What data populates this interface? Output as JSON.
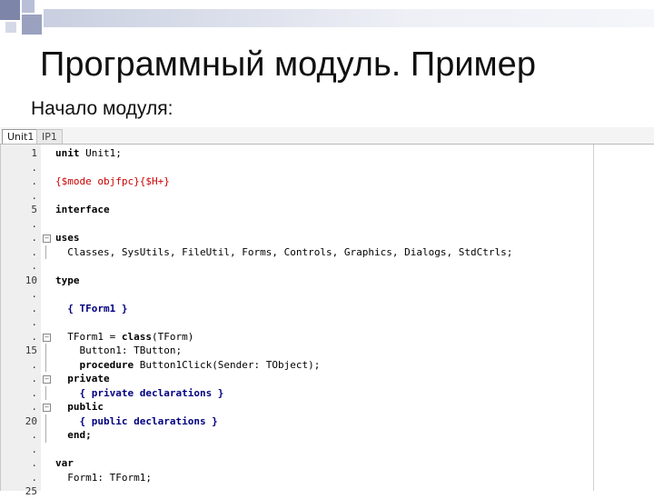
{
  "slide": {
    "title": "Программный модуль. Пример",
    "subtitle": "Начало модуля:"
  },
  "editor": {
    "tabs": [
      {
        "label": "Unit1",
        "active": true
      },
      {
        "label": "IP1",
        "active": false
      }
    ],
    "line_numbers": [
      "1",
      ".",
      ".",
      ".",
      "5",
      ".",
      ".",
      ".",
      ".",
      "10",
      ".",
      ".",
      ".",
      ".",
      "15",
      ".",
      ".",
      ".",
      ".",
      "20",
      ".",
      ".",
      ".",
      ".",
      "25"
    ],
    "code_lines": [
      {
        "segments": [
          {
            "t": "unit ",
            "c": "kw"
          },
          {
            "t": "Unit1;",
            "c": "id"
          }
        ]
      },
      {
        "segments": []
      },
      {
        "segments": [
          {
            "t": "{$mode objfpc}{$H+}",
            "c": "dir"
          }
        ]
      },
      {
        "segments": []
      },
      {
        "segments": [
          {
            "t": "interface",
            "c": "kw"
          }
        ]
      },
      {
        "segments": []
      },
      {
        "segments": [
          {
            "t": "uses",
            "c": "kw"
          }
        ]
      },
      {
        "segments": [
          {
            "t": "  Classes, SysUtils, FileUtil, Forms, Controls, Graphics, Dialogs, StdCtrls;",
            "c": "id"
          }
        ]
      },
      {
        "segments": []
      },
      {
        "segments": [
          {
            "t": "type",
            "c": "kw"
          }
        ]
      },
      {
        "segments": []
      },
      {
        "segments": [
          {
            "t": "  { TForm1 }",
            "c": "cm"
          }
        ]
      },
      {
        "segments": []
      },
      {
        "segments": [
          {
            "t": "  TForm1 = ",
            "c": "id"
          },
          {
            "t": "class",
            "c": "kw"
          },
          {
            "t": "(TForm)",
            "c": "id"
          }
        ]
      },
      {
        "segments": [
          {
            "t": "    Button1: TButton;",
            "c": "id"
          }
        ]
      },
      {
        "segments": [
          {
            "t": "    procedure ",
            "c": "kw"
          },
          {
            "t": "Button1Click(Sender: TObject);",
            "c": "id"
          }
        ]
      },
      {
        "segments": [
          {
            "t": "  private",
            "c": "kw"
          }
        ]
      },
      {
        "segments": [
          {
            "t": "    { private declarations }",
            "c": "cm"
          }
        ]
      },
      {
        "segments": [
          {
            "t": "  public",
            "c": "kw"
          }
        ]
      },
      {
        "segments": [
          {
            "t": "    { public declarations }",
            "c": "cm"
          }
        ]
      },
      {
        "segments": [
          {
            "t": "  end;",
            "c": "kw"
          }
        ]
      },
      {
        "segments": []
      },
      {
        "segments": [
          {
            "t": "var",
            "c": "kw"
          }
        ]
      },
      {
        "segments": [
          {
            "t": "  Form1: TForm1;",
            "c": "id"
          }
        ]
      },
      {
        "segments": []
      }
    ]
  }
}
